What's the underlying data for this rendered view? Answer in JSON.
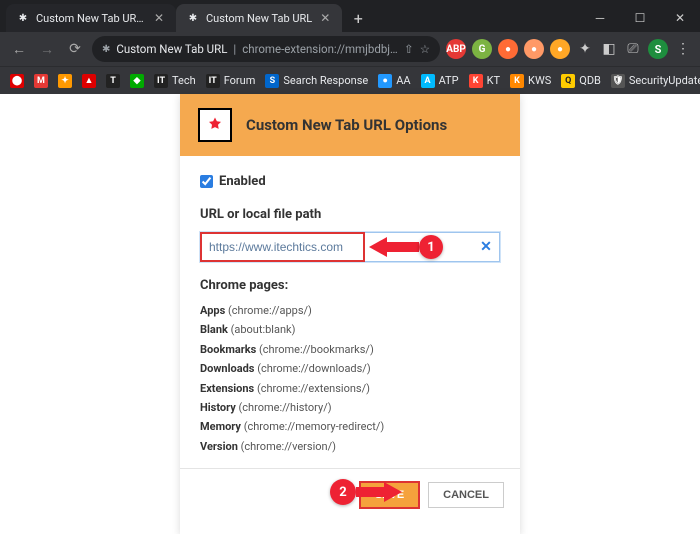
{
  "window": {
    "tab1": {
      "title": "Custom New Tab URL - Chrome"
    },
    "tab2": {
      "title": "Custom New Tab URL"
    }
  },
  "toolbar": {
    "site": "Custom New Tab URL",
    "url": "chrome-extension://mmjbdbjnoablegbkcklggeknkfcjkjia/o..."
  },
  "bookmarks": {
    "m": "M",
    "a": "A",
    "t": "T",
    "it": "IT",
    "tech": "Tech",
    "it2": "IT",
    "forum": "Forum",
    "sr": "Search Response",
    "aa": "AA",
    "atp": "ATP",
    "kt": "KT",
    "kws": "KWS",
    "qdb": "QDB",
    "su": "SecurityUpdates"
  },
  "panel": {
    "title": "Custom New Tab URL Options",
    "enabled_label": "Enabled",
    "url_label": "URL or local file path",
    "url_value": "https://www.itechtics.com",
    "chrome_pages_label": "Chrome pages:",
    "pages": [
      {
        "name": "Apps",
        "path": "(chrome://apps/)"
      },
      {
        "name": "Blank",
        "path": "(about:blank)"
      },
      {
        "name": "Bookmarks",
        "path": "(chrome://bookmarks/)"
      },
      {
        "name": "Downloads",
        "path": "(chrome://downloads/)"
      },
      {
        "name": "Extensions",
        "path": "(chrome://extensions/)"
      },
      {
        "name": "History",
        "path": "(chrome://history/)"
      },
      {
        "name": "Memory",
        "path": "(chrome://memory-redirect/)"
      },
      {
        "name": "Version",
        "path": "(chrome://version/)"
      }
    ],
    "save_label": "SAVE",
    "cancel_label": "CANCEL"
  },
  "annotations": {
    "one": "1",
    "two": "2"
  }
}
